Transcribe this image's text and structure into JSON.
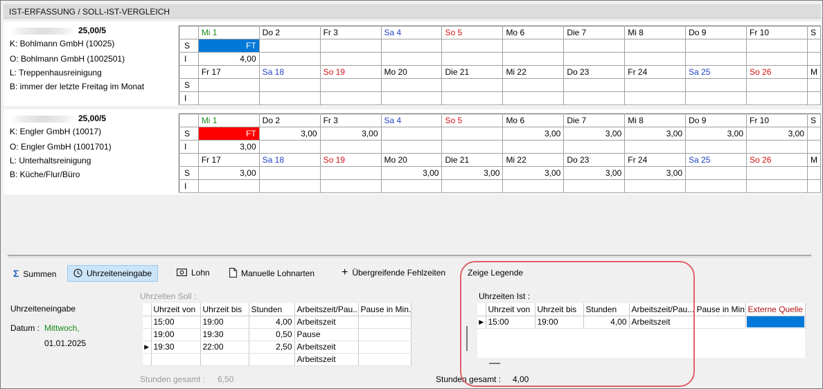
{
  "title": "IST-ERFASSUNG / SOLL-IST-VERGLEICH",
  "emp1": {
    "hours": "25,00/5",
    "kunde": "K: Bohlmann GmbH (10025)",
    "objekt": "O: Bohlmann GmbH (1002501)",
    "leistung": "L: Treppenhausreinigung",
    "bemerkung": "B: immer der letzte Freitag im Monat",
    "week1_days": [
      "Mi 1",
      "Do 2",
      "Fr 3",
      "Sa 4",
      "So 5",
      "Mo 6",
      "Die 7",
      "Mi 8",
      "Do 9",
      "Fr 10",
      "S"
    ],
    "week1_soll": [
      "FT",
      "",
      "",
      "",
      "",
      "",
      "",
      "",
      "",
      "",
      ""
    ],
    "week1_ist": [
      "4,00",
      "",
      "",
      "",
      "",
      "",
      "",
      "",
      "",
      "",
      ""
    ],
    "week2_days": [
      "Fr 17",
      "Sa 18",
      "So 19",
      "Mo 20",
      "Die 21",
      "Mi 22",
      "Do 23",
      "Fr 24",
      "Sa 25",
      "So 26",
      "M"
    ],
    "week2_soll": [
      "",
      "",
      "",
      "",
      "",
      "",
      "",
      "",
      "",
      "",
      ""
    ],
    "week2_ist": [
      "",
      "",
      "",
      "",
      "",
      "",
      "",
      "",
      "",
      "",
      ""
    ]
  },
  "emp2": {
    "hours": "25,00/5",
    "kunde": "K: Engler GmbH (10017)",
    "objekt": "O: Engler GmbH (1001701)",
    "leistung": "L: Unterhaltsreinigung",
    "bemerkung": "B: Küche/Flur/Büro",
    "week1_days": [
      "Mi 1",
      "Do 2",
      "Fr 3",
      "Sa 4",
      "So 5",
      "Mo 6",
      "Die 7",
      "Mi 8",
      "Do 9",
      "Fr 10",
      "S"
    ],
    "week1_soll": [
      "FT",
      "3,00",
      "3,00",
      "",
      "",
      "3,00",
      "3,00",
      "3,00",
      "3,00",
      "3,00",
      ""
    ],
    "week1_ist": [
      "3,00",
      "",
      "",
      "",
      "",
      "",
      "",
      "",
      "",
      "",
      ""
    ],
    "week2_days": [
      "Fr 17",
      "Sa 18",
      "So 19",
      "Mo 20",
      "Die 21",
      "Mi 22",
      "Do 23",
      "Fr 24",
      "Sa 25",
      "So 26",
      "M"
    ],
    "week2_soll": [
      "3,00",
      "",
      "",
      "3,00",
      "3,00",
      "3,00",
      "3,00",
      "3,00",
      "",
      "",
      ""
    ],
    "week2_ist": [
      "",
      "",
      "",
      "",
      "",
      "",
      "",
      "",
      "",
      "",
      ""
    ]
  },
  "row_labels": {
    "soll": "S",
    "ist": "I"
  },
  "toolbar": {
    "summen": "Summen",
    "uhrzeiteneingabe": "Uhrzeiteneingabe",
    "lohn": "Lohn",
    "manuelle_lohnarten": "Manuelle Lohnarten",
    "fehlzeiten": "Übergreifende Fehlzeiten",
    "legende": "Zeige Legende"
  },
  "left": {
    "section": "Uhrzeiteneingabe",
    "datum_label": "Datum :",
    "weekday": "Mittwoch,",
    "date": "01.01.2025"
  },
  "soll": {
    "label": "Uhrzeiten Soll :",
    "headers": [
      "Uhrzeit von",
      "Uhrzeit bis",
      "Stunden",
      "Arbeitszeit/Pau...",
      "Pause in Min."
    ],
    "rows": [
      [
        "15:00",
        "19:00",
        "4,00",
        "Arbeitszeit",
        ""
      ],
      [
        "19:00",
        "19:30",
        "0,50",
        "Pause",
        ""
      ],
      [
        "19:30",
        "22:00",
        "2,50",
        "Arbeitszeit",
        ""
      ],
      [
        "",
        "",
        "",
        "Arbeitszeit",
        ""
      ]
    ],
    "total_label": "Stunden gesamt :",
    "total": "6,50"
  },
  "ist": {
    "label": "Uhrzeiten Ist :",
    "headers": [
      "Uhrzeit von",
      "Uhrzeit bis",
      "Stunden",
      "Arbeitszeit/Pau...",
      "Pause in Min.",
      "Externe Quelle"
    ],
    "rows": [
      [
        "15:00",
        "19:00",
        "4,00",
        "Arbeitszeit",
        "",
        ""
      ]
    ],
    "total_label": "Stunden gesamt :",
    "total": "4,00"
  },
  "colors": {
    "selection_blue": "#0078d7",
    "holiday_red": "#ff0000",
    "annotation": "#e0606a"
  }
}
